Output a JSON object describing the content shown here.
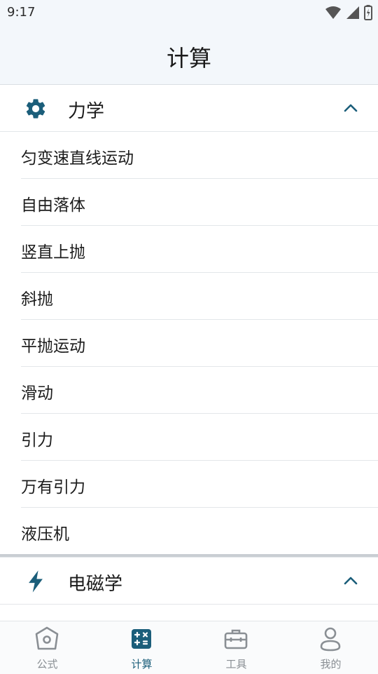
{
  "status": {
    "time": "9:17"
  },
  "app_bar": {
    "title": "计算"
  },
  "sections": [
    {
      "title": "力学",
      "icon": "gear-icon",
      "items": [
        "匀变速直线运动",
        "自由落体",
        "竖直上抛",
        "斜抛",
        "平抛运动",
        "滑动",
        "引力",
        "万有引力",
        "液压机"
      ]
    },
    {
      "title": "电磁学",
      "icon": "lightning-icon",
      "items": []
    }
  ],
  "bottom_nav": {
    "items": [
      {
        "label": "公式",
        "icon": "formula-icon",
        "active": false
      },
      {
        "label": "计算",
        "icon": "calculator-icon",
        "active": true
      },
      {
        "label": "工具",
        "icon": "toolbox-icon",
        "active": false
      },
      {
        "label": "我的",
        "icon": "profile-icon",
        "active": false
      }
    ]
  },
  "colors": {
    "accent": "#1b5e7a",
    "inactive": "#8a8f94",
    "app_bar_bg": "#f3f7fb"
  }
}
